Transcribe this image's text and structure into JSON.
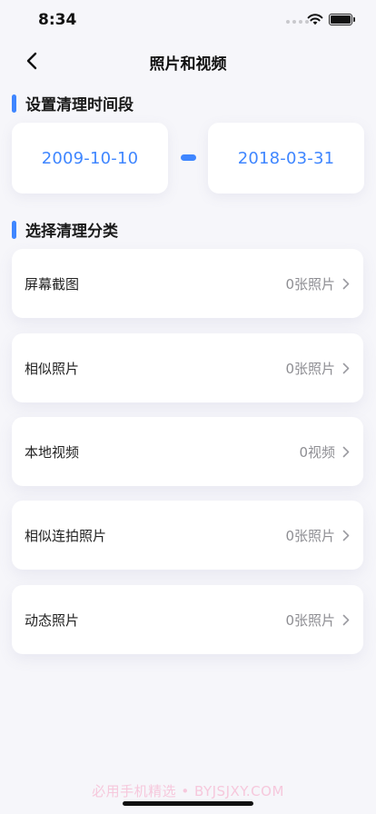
{
  "status": {
    "time": "8:34"
  },
  "nav": {
    "title": "照片和视频"
  },
  "time_section": {
    "title": "设置清理时间段",
    "start_date": "2009-10-10",
    "end_date": "2018-03-31"
  },
  "category_section": {
    "title": "选择清理分类",
    "items": [
      {
        "name": "屏幕截图",
        "count": "0张照片"
      },
      {
        "name": "相似照片",
        "count": "0张照片"
      },
      {
        "name": "本地视频",
        "count": "0视频"
      },
      {
        "name": "相似连拍照片",
        "count": "0张照片"
      },
      {
        "name": "动态照片",
        "count": "0张照片"
      }
    ]
  },
  "watermark": "必用手机精选 • BYJSJXY.COM",
  "colors": {
    "accent": "#3f86ff",
    "background": "#f6f6fa",
    "card": "#ffffff"
  },
  "icons": {
    "back": "chevron-left-icon",
    "row_arrow": "chevron-right-icon"
  }
}
